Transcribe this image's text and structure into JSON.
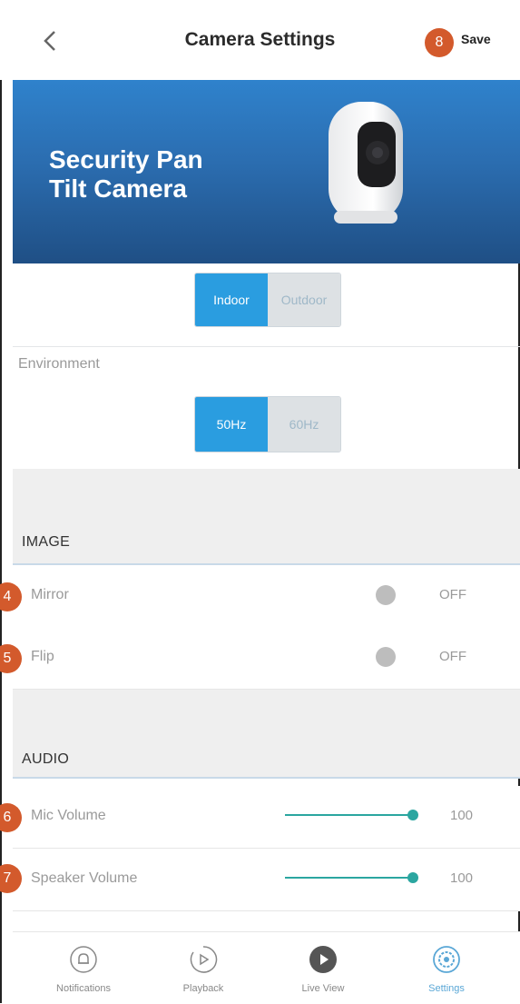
{
  "header": {
    "title": "Camera Settings",
    "save_label": "Save",
    "save_badge": "8"
  },
  "hero": {
    "title_line1": "Security Pan",
    "title_line2": "Tilt Camera"
  },
  "mode_toggle": {
    "options": [
      "Indoor",
      "Outdoor"
    ],
    "selected": "Indoor"
  },
  "environment": {
    "label": "Environment",
    "options": [
      "50Hz",
      "60Hz"
    ],
    "selected": "50Hz"
  },
  "image_section": {
    "title": "IMAGE",
    "rows": [
      {
        "badge": "4",
        "label": "Mirror",
        "state": "OFF"
      },
      {
        "badge": "5",
        "label": "Flip",
        "state": "OFF"
      }
    ]
  },
  "audio_section": {
    "title": "AUDIO",
    "rows": [
      {
        "badge": "6",
        "label": "Mic Volume",
        "value": "100"
      },
      {
        "badge": "7",
        "label": "Speaker Volume",
        "value": "100"
      }
    ]
  },
  "tabs": [
    {
      "label": "Notifications",
      "icon": "bell-icon"
    },
    {
      "label": "Playback",
      "icon": "playback-icon"
    },
    {
      "label": "Live View",
      "icon": "play-icon"
    },
    {
      "label": "Settings",
      "icon": "gear-icon",
      "active": true
    }
  ],
  "colors": {
    "accent": "#2a9de0",
    "badge": "#d35a2c",
    "slider": "#2ba6a0",
    "hero": "#2b6db0"
  }
}
